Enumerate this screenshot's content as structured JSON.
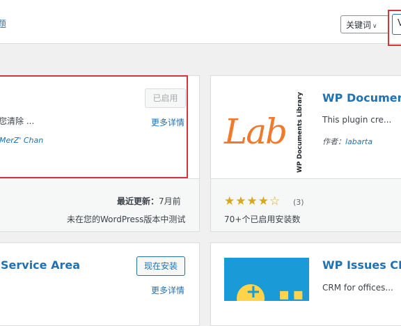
{
  "topbar": {
    "partial_text": "题",
    "search_type": "关键词",
    "search_value": "V"
  },
  "plugins": [
    {
      "button_label": "已启用",
      "description": "您清除 ...",
      "more_details": "更多详情",
      "author": "MerZ' Chan",
      "last_updated_label": "最近更新：",
      "last_updated_value": "7月前",
      "compat": "未在您的WordPress版本中测试"
    },
    {
      "title": "WP Document",
      "description": "This plugin cre...",
      "author_prefix": "作者：",
      "author": "labarta",
      "rating": 4,
      "rating_max": 5,
      "rating_stars": "★★★★☆",
      "rating_count": "(3)",
      "installs": "70+个已启用安装数",
      "logo_text": "Lab",
      "logo_side_text": "WP Documents Library"
    },
    {
      "title": "Service Area",
      "button_label": "现在安装",
      "more_details": "更多详情"
    },
    {
      "title": "WP Issues CRM",
      "description": "CRM for offices..."
    }
  ],
  "colors": {
    "accent": "#2271b1",
    "highlight_border": "#d63638",
    "star": "#dba617",
    "logo_orange": "#ef7a2e",
    "crm_blue": "#1a9ad6",
    "crm_yellow": "#ffd34a"
  }
}
